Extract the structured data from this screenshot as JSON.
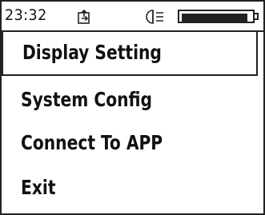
{
  "status_bar": {
    "time": "23:32",
    "icons": [
      "export-icon",
      "light-icon",
      "battery-icon"
    ],
    "battery_level": 0.95
  },
  "menu": {
    "items": [
      {
        "label": "Display Setting",
        "selected": true
      },
      {
        "label": "System Config",
        "selected": false
      },
      {
        "label": "Connect To APP",
        "selected": false
      },
      {
        "label": "Exit",
        "selected": false
      }
    ]
  },
  "colors": {
    "foreground": "#111111",
    "background": "#ffffff"
  }
}
